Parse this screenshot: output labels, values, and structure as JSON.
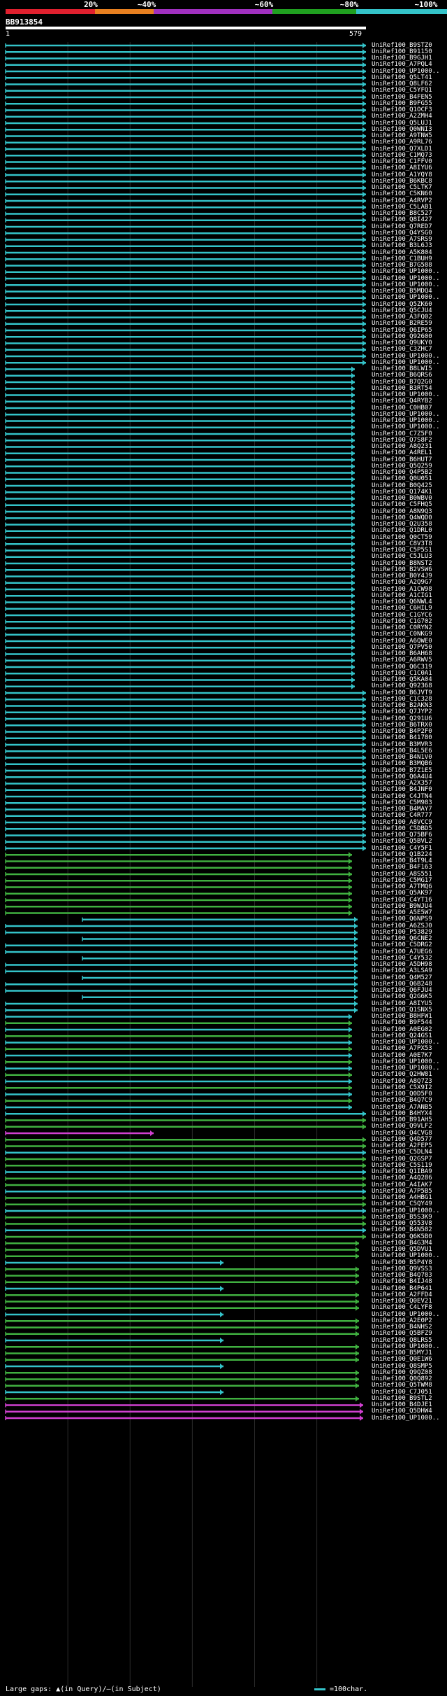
{
  "scale": {
    "labels": [
      "20%",
      "~40%",
      "~60%",
      "~80%",
      "~100%"
    ],
    "colors": [
      "#e0202e",
      "#e88020",
      "#a030c0",
      "#20a020",
      "#34c3c9"
    ]
  },
  "query": {
    "id": "BB913854",
    "start": "1",
    "end": "579"
  },
  "hit_colors": {
    "cyan": "#34c3c9",
    "green": "#40b040",
    "magenta": "#d040d0"
  },
  "hits": [
    "UniRef100_B9STZ0",
    "UniRef100_B91150",
    "UniRef100_B9GJH1",
    "UniRef100_A7PQL4",
    "UniRef100_UP1000..",
    "UniRef100_Q5LT41",
    "UniRef100_Q8LF62",
    "UniRef100_C5YFQ1",
    "UniRef100_B4FEN5",
    "UniRef100_B9FG55",
    "UniRef100_Q1OCF3",
    "UniRef100_A2ZMH4",
    "UniRef100_Q5LUJ1",
    "UniRef100_Q0WNI3",
    "UniRef100_A9TNW5",
    "UniRef100_A9RL76",
    "UniRef100_Q7XLD1",
    "UniRef100_C1MQ73",
    "UniRef100_C1FFV0",
    "UniRef100_A8IYU6",
    "UniRef100_A1YQY8",
    "UniRef100_B6KBC8",
    "UniRef100_C5LTK7",
    "UniRef100_C5KN60",
    "UniRef100_A4RVP2",
    "UniRef100_C5LAB1",
    "UniRef100_B8C527",
    "UniRef100_Q8I427",
    "UniRef100_Q7RED7",
    "UniRef100_Q4YSG0",
    "UniRef100_A7SRS9",
    "UniRef100_B3L6J3",
    "UniRef100_A5K804",
    "UniRef100_C1BUH9",
    "UniRef100_B7G588",
    "UniRef100_UP1000..",
    "UniRef100_UP1000..",
    "UniRef100_UP1000..",
    "UniRef100_B5MDQ4",
    "UniRef100_UP1000..",
    "UniRef100_Q5ZK60",
    "UniRef100_Q5CJU4",
    "UniRef100_A3FQ02",
    "UniRef100_B2RE59",
    "UniRef100_Q6IP65",
    "UniRef100_Q92600",
    "UniRef100_Q9UKY0",
    "UniRef100_C3ZHC7",
    "UniRef100_UP1000..",
    "UniRef100_UP1000..",
    "UniRef100_B8LWI5",
    "UniRef100_B6QRS6",
    "UniRef100_B7Q2G0",
    "UniRef100_B3RT54",
    "UniRef100_UP1000..",
    "UniRef100_Q4RYB2",
    "UniRef100_C0HB07",
    "UniRef100_UP1000..",
    "UniRef100_UP1000..",
    "UniRef100_UP1000..",
    "UniRef100_C7Z5F0",
    "UniRef100_Q7S8F2",
    "UniRef100_A8Q231",
    "UniRef100_A4REL1",
    "UniRef100_B6HUT7",
    "UniRef100_Q5Q259",
    "UniRef100_Q4P5B2",
    "UniRef100_Q0U051",
    "UniRef100_B0Q425",
    "UniRef100_Q174K1",
    "UniRef100_B0WBV0",
    "UniRef100_C5FHQ5",
    "UniRef100_A8N9Q3",
    "UniRef100_Q4WQD0",
    "UniRef100_Q2U358",
    "UniRef100_Q1DRL0",
    "UniRef100_Q0CT59",
    "UniRef100_C8V3T8",
    "UniRef100_C5P5S1",
    "UniRef100_C5JLU3",
    "UniRef100_B8NST2",
    "UniRef100_B2VSW6",
    "UniRef100_B0Y4J9",
    "UniRef100_A2Q9G7",
    "UniRef100_A1CW98",
    "UniRef100_A1CIG1",
    "UniRef100_Q6NWL4",
    "UniRef100_C6HIL9",
    "UniRef100_C1GYC6",
    "UniRef100_C1G702",
    "UniRef100_C0RYN2",
    "UniRef100_C0NKG9",
    "UniRef100_A6QWE0",
    "UniRef100_Q7PV50",
    "UniRef100_B6AH68",
    "UniRef100_A6RWV5",
    "UniRef100_Q6C319",
    "UniRef100_C1C0A1",
    "UniRef100_Q5KA04",
    "UniRef100_Q92368",
    "UniRef100_B6JVT9",
    "UniRef100_C1C328",
    "UniRef100_B2AKN3",
    "UniRef100_Q7JYP2",
    "UniRef100_Q291U6",
    "UniRef100_B6TRX0",
    "UniRef100_B4P2F0",
    "UniRef100_B41780",
    "UniRef100_B3MVR3",
    "UniRef100_B4L5E6",
    "UniRef100_B4N1V0",
    "UniRef100_B3MQB6",
    "UniRef100_B7Z1E5",
    "UniRef100_Q6A4U4",
    "UniRef100_A2X357",
    "UniRef100_B4JNF0",
    "UniRef100_C4JTN4",
    "UniRef100_C5M983",
    "UniRef100_B4MAY7",
    "UniRef100_C4R777",
    "UniRef100_A8VCC9",
    "UniRef100_C5DBD5",
    "UniRef100_Q75BF6",
    "UniRef100_Q5BVL2",
    "UniRef100_C4Y5F1",
    "UniRef100_Q1B224",
    "UniRef100_B4T9L4",
    "UniRef100_B4F163",
    "UniRef100_A8S551",
    "UniRef100_C5MG17",
    "UniRef100_A7TMQ6",
    "UniRef100_Q5AK97",
    "UniRef100_C4YT16",
    "UniRef100_B9WJU4",
    "UniRef100_A5E5W7",
    "UniRef100_Q6NPS9",
    "UniRef100_A6ZSJ0",
    "UniRef100_P53829",
    "UniRef100_Q6CNE2",
    "UniRef100_C5DRG2",
    "UniRef100_A7UEG6",
    "UniRef100_C4Y532",
    "UniRef100_A5DH98",
    "UniRef100_A3LSA9",
    "UniRef100_Q4M527",
    "UniRef100_Q6B248",
    "UniRef100_Q6FJU4",
    "UniRef100_Q2G6K5",
    "UniRef100_A8IYU5",
    "UniRef100_Q1SNX5",
    "UniRef100_B8HFW1",
    "UniRef100_B9F544",
    "UniRef100_A0EG02",
    "UniRef100_Q24GS1",
    "UniRef100_UP1000..",
    "UniRef100_A7PX53",
    "UniRef100_A0E7K7",
    "UniRef100_UP1000..",
    "UniRef100_UP1000..",
    "UniRef100_Q2HW81",
    "UniRef100_A8Q7Z3",
    "UniRef100_C5X9I2",
    "UniRef100_Q0D5F0",
    "UniRef100_B4Q7C9",
    "UniRef100_A7ANB5",
    "UniRef100_B4HYX4",
    "UniRef100_B91AH5",
    "UniRef100_Q9VLF2",
    "UniRef100_Q4CVG8",
    "UniRef100_Q4D577",
    "UniRef100_A2FEP5",
    "UniRef100_C5DLN4",
    "UniRef100_Q2GSP7",
    "UniRef100_C5S119",
    "UniRef100_Q1IBA9",
    "UniRef100_A4Q286",
    "UniRef100_A4IAK7",
    "UniRef100_A7P5B5",
    "UniRef100_A4HBG1",
    "UniRef100_C5QY49",
    "UniRef100_UP1000..",
    "UniRef100_B5S3K9",
    "UniRef100_Q553V8",
    "UniRef100_B4N582",
    "UniRef100_Q6K5B0",
    "UniRef100_B4G3M4",
    "UniRef100_Q5DVU1",
    "UniRef100_UP1000..",
    "UniRef100_B5P4Y8",
    "UniRef100_Q9VSS3",
    "UniRef100_B4Q783",
    "UniRef100_B4IJ48",
    "UniRef100_B4P641",
    "UniRef100_A2FFD4",
    "UniRef100_Q0EV21",
    "UniRef100_C4LYF8",
    "UniRef100_UP1000..",
    "UniRef100_A2E0P2",
    "UniRef100_B4NHS2",
    "UniRef100_Q5BFZ9",
    "UniRef100_Q8LRS5",
    "UniRef100_UP1000..",
    "UniRef100_B5MYJ1",
    "UniRef100_Q0E1W6",
    "UniRef100_Q8SMP5",
    "UniRef100_Q9QZ08",
    "UniRef100_Q0Q892",
    "UniRef100_Q5TWM8",
    "UniRef100_C7J051",
    "UniRef100_B9STL2",
    "UniRef100_B4DJE1",
    "UniRef100_Q5DHW4",
    "UniRef100_UP1000.."
  ],
  "footer": {
    "legend": "Large gaps: ▲(in Query)/—(in Subject)",
    "scale_note": "=100char."
  }
}
